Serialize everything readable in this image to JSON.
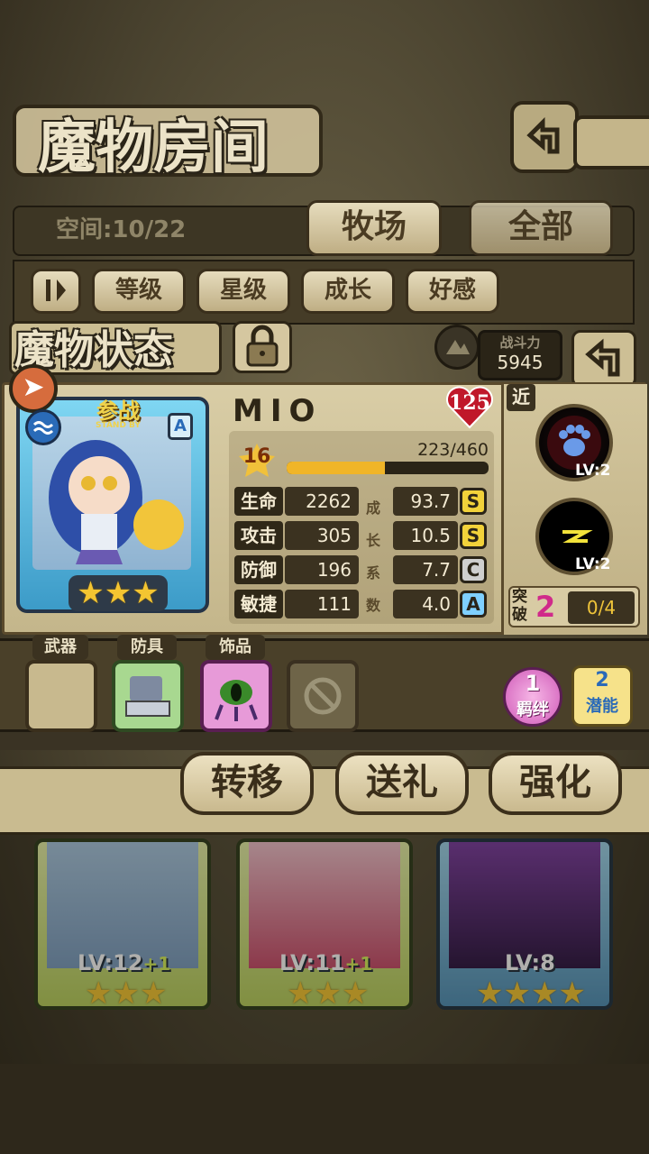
{
  "header": {
    "title": "魔物房间",
    "back_icon": "back-arrow-icon"
  },
  "room": {
    "space_label": "空间:10/22"
  },
  "tabs": [
    {
      "label": "牧场"
    },
    {
      "label": "全部"
    }
  ],
  "sort": {
    "toggle_icon": "pause-sort-icon",
    "buttons": [
      {
        "label": "等级"
      },
      {
        "label": "星级"
      },
      {
        "label": "成长"
      },
      {
        "label": "好感"
      }
    ]
  },
  "status": {
    "title": "魔物状态",
    "power_label": "战斗力",
    "power_value": "5945",
    "lock_icon": "padlock-icon"
  },
  "monster": {
    "name": "MIO",
    "affection": "125",
    "level": "16",
    "exp": "223/460",
    "exp_fraction": 0.485,
    "standby_label": "参战",
    "standby_sub": "STAND BY",
    "rank": "A",
    "element_icon": "water-wave-icon",
    "stars": 3,
    "stats": [
      {
        "label": "生命",
        "value": "2262",
        "growth": "93.7",
        "grade": "S"
      },
      {
        "label": "攻击",
        "value": "305",
        "growth": "10.5",
        "grade": "S"
      },
      {
        "label": "防御",
        "value": "196",
        "growth": "7.7",
        "grade": "C"
      },
      {
        "label": "敏捷",
        "value": "111",
        "growth": "4.0",
        "grade": "A"
      }
    ],
    "growth_vertical": [
      "成",
      "长",
      "系",
      "数"
    ]
  },
  "skills": {
    "range_label": "近",
    "items": [
      {
        "icon": "paw-skill-icon",
        "level": "LV:2"
      },
      {
        "icon": "lightning-skill-icon",
        "level": "LV:2"
      }
    ],
    "breakthrough_label": "突破",
    "breakthrough_level": "2",
    "breakthrough_progress": "0/4"
  },
  "equipment": {
    "weapon_label": "武器",
    "armor_label": "防具",
    "accessory_label": "饰品",
    "armor_icon": "boot-armor-icon",
    "accessory_icon": "eye-charm-icon",
    "locked_icon": "prohibited-icon"
  },
  "bonds": {
    "bond_count": "1",
    "bond_label": "羁绊",
    "potential_count": "2",
    "potential_label": "潜能"
  },
  "actions": [
    {
      "label": "转移"
    },
    {
      "label": "送礼"
    },
    {
      "label": "强化"
    }
  ],
  "roster": [
    {
      "level": "LV:12",
      "bonus": "+1",
      "stars": 3
    },
    {
      "level": "LV:11",
      "bonus": "+1",
      "stars": 3
    },
    {
      "level": "LV:8",
      "bonus": "",
      "stars": 4
    }
  ],
  "colors": {
    "grade_s": "#f2d23a",
    "grade_c": "#cfcfcf",
    "grade_a": "#7fd0ff",
    "affection": "#c0182a",
    "exp_bar": "#f0b528"
  }
}
